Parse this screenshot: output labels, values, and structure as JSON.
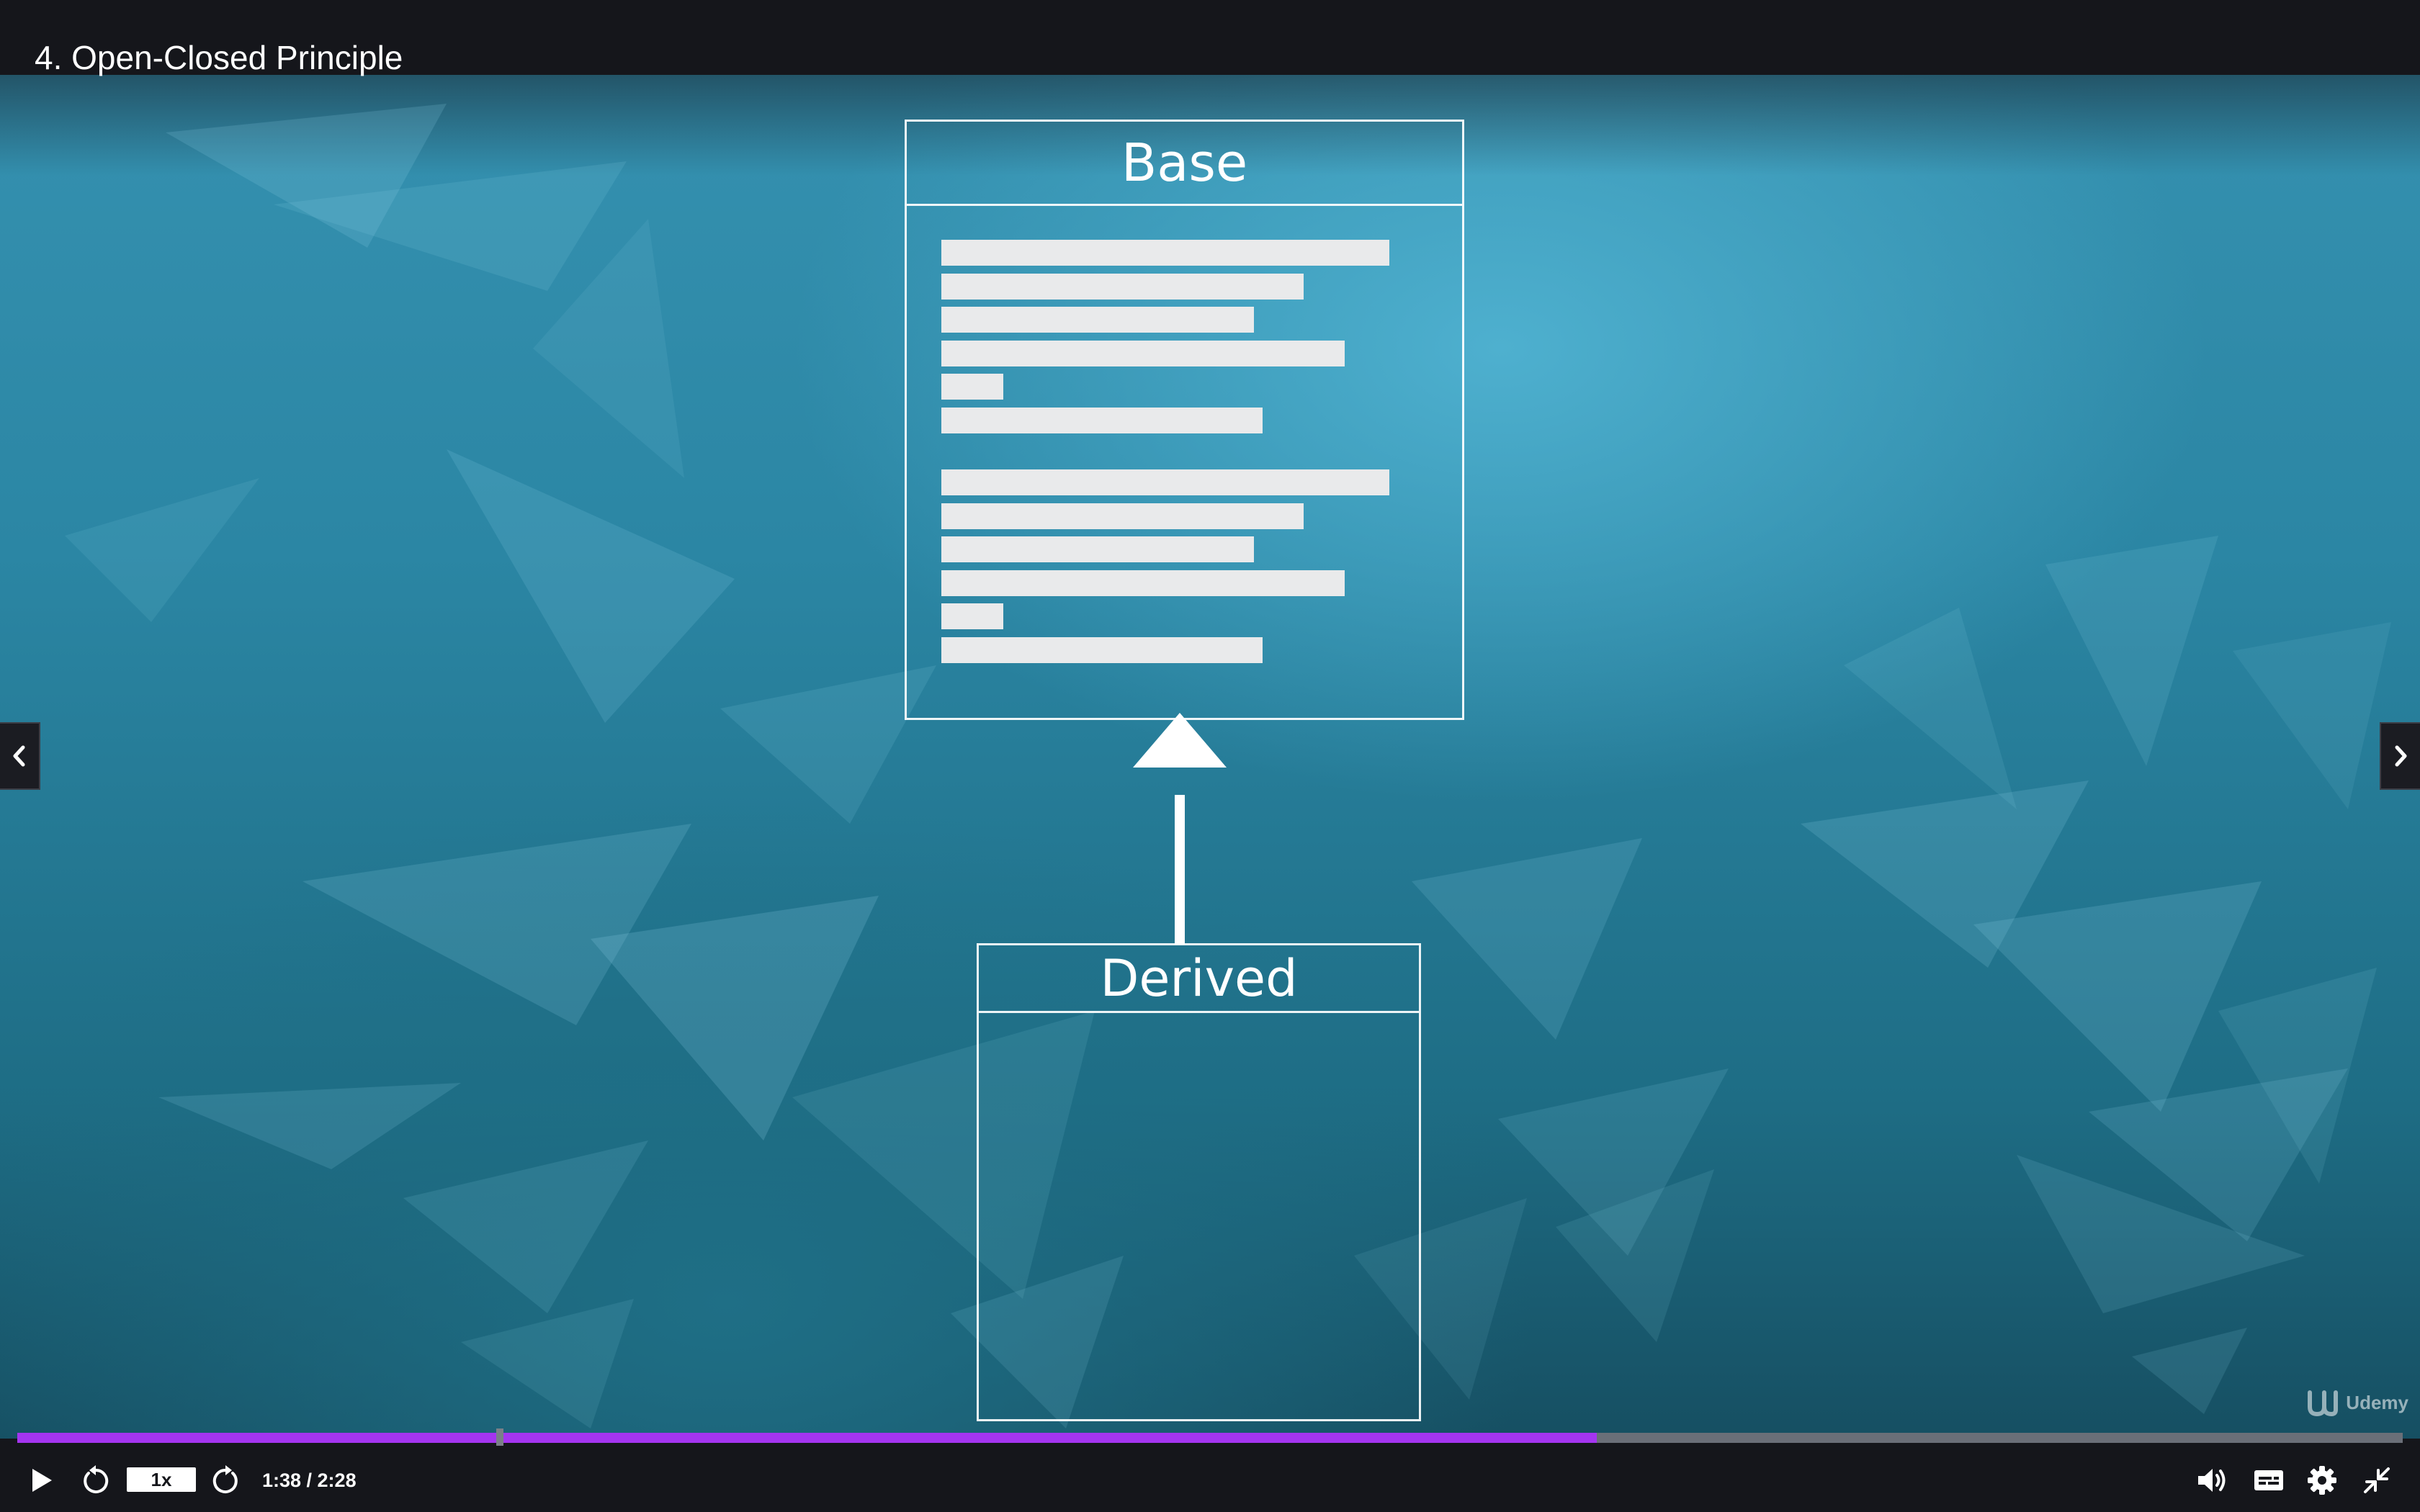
{
  "lecture": {
    "title": "4. Open-Closed Principle"
  },
  "diagram": {
    "base_class": {
      "name": "Base"
    },
    "derived_class": {
      "name": "Derived"
    },
    "relationship": "inherits"
  },
  "navigation": {
    "prev_icon": "chevron-left-icon",
    "next_icon": "chevron-right-icon"
  },
  "watermark": {
    "brand": "Udemy"
  },
  "player": {
    "playback_speed": "1x",
    "current_time": "1:38",
    "separator": " / ",
    "duration": "2:28",
    "time_display": "1:38 / 2:28",
    "progress_fraction": 0.662,
    "buffered_fraction": 0.662,
    "icons": {
      "play": "play-icon",
      "rewind": "rewind-5-icon",
      "forward": "forward-5-icon",
      "volume": "volume-icon",
      "captions": "captions-icon",
      "settings": "gear-icon",
      "fullscreen": "exit-fullscreen-icon"
    }
  },
  "colors": {
    "progress": "#a435f0",
    "chrome": "#15161b",
    "video_background": "#2b86a4"
  }
}
